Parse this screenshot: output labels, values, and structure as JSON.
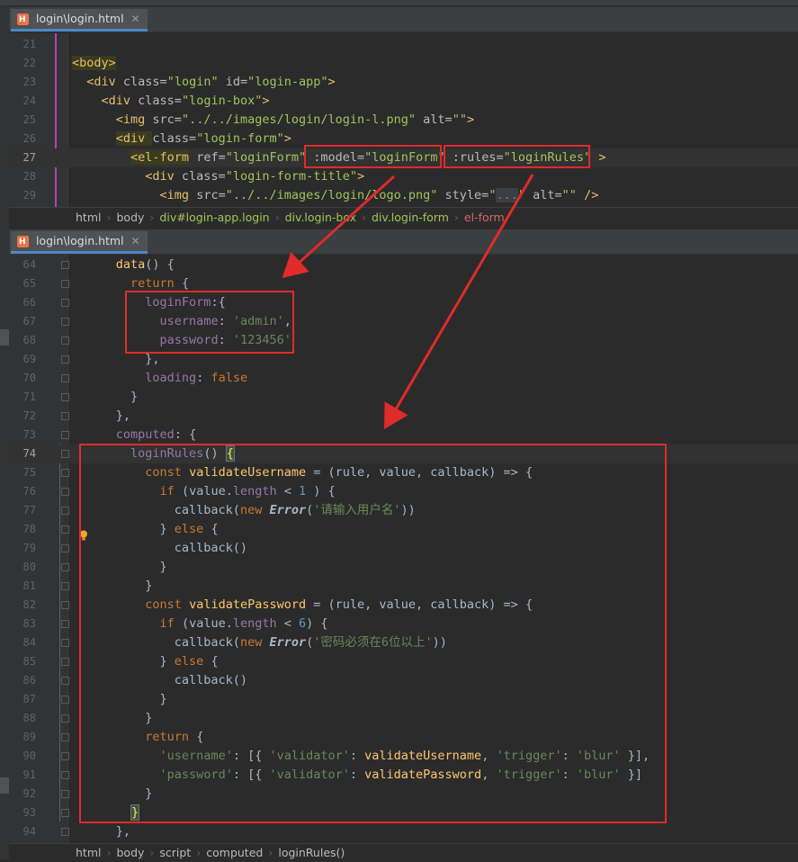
{
  "tab1": {
    "label": "login\\login.html",
    "close": "✕"
  },
  "tab2": {
    "label": "login\\login.html",
    "close": "✕"
  },
  "editor1_lines": [
    {
      "n": "21",
      "html": ""
    },
    {
      "n": "22",
      "html": "<span class=\"t-tagbg\">&lt;body&gt;</span>"
    },
    {
      "n": "23",
      "html": "  <span class=\"t-tag\">&lt;div </span><span class=\"t-attr\">class=</span><span class=\"t-str\">\"login\"</span> <span class=\"t-attr\">id=</span><span class=\"t-str\">\"login-app\"</span><span class=\"t-tag\">&gt;</span>"
    },
    {
      "n": "24",
      "html": "    <span class=\"t-tag\">&lt;div </span><span class=\"t-attr\">class=</span><span class=\"t-str\">\"login-box\"</span><span class=\"t-tag\">&gt;</span>"
    },
    {
      "n": "25",
      "html": "      <span class=\"t-tag\">&lt;img </span><span class=\"t-attr\">src=</span><span class=\"t-str\">\"../../images/login/login-l.png\"</span> <span class=\"t-attr\">alt=</span><span class=\"t-str\">\"\"</span><span class=\"t-tag\">&gt;</span>"
    },
    {
      "n": "26",
      "html": "      <span class=\"t-tagbg\">&lt;div </span><span class=\"t-attr\">class=</span><span class=\"t-str\">\"login-form\"</span><span class=\"t-tag\">&gt;</span>"
    },
    {
      "n": "27",
      "html": "        <span class=\"t-tagbg\">&lt;el-form</span> <span class=\"t-attr\">ref=</span><span class=\"t-str\">\"loginForm\"</span> <span class=\"t-attr\">:model=</span><span class=\"t-str\">\"loginForm\"</span> <span class=\"t-attr\">:rules=</span><span class=\"t-str\">\"loginRules\"</span> <span class=\"t-tag\">&gt;</span>",
      "cur": true
    },
    {
      "n": "28",
      "html": "          <span class=\"t-tag\">&lt;div </span><span class=\"t-attr\">class=</span><span class=\"t-str\">\"login-form-title\"</span><span class=\"t-tag\">&gt;</span>"
    },
    {
      "n": "29",
      "html": "            <span class=\"t-tag\">&lt;img </span><span class=\"t-attr\">src=</span><span class=\"t-str\">\"../../images/login/logo.png\"</span> <span class=\"t-attr\">style=</span><span class=\"t-str\">\"</span><span class=\"t-ghost\">...</span><span class=\"t-str\">\"</span> <span class=\"t-attr\">alt=</span><span class=\"t-str\">\"\"</span> <span class=\"t-tag\">/&gt;</span>"
    }
  ],
  "breadcrumb1": [
    {
      "label": "html",
      "kind": "c-html"
    },
    {
      "label": "body",
      "kind": "c-html"
    },
    {
      "label": "div#login-app.login",
      "kind": "c-tag"
    },
    {
      "label": "div.login-box",
      "kind": "c-tag"
    },
    {
      "label": "div.login-form",
      "kind": "c-tag"
    },
    {
      "label": "el-form",
      "kind": "c-el"
    }
  ],
  "editor2_lines": [
    {
      "n": "64",
      "html": "      <span class=\"t-fn\">data</span>() {"
    },
    {
      "n": "65",
      "html": "        <span class=\"t-kw\">return</span> {"
    },
    {
      "n": "66",
      "html": "          <span class=\"t-prop\">loginForm</span>:{"
    },
    {
      "n": "67",
      "html": "            <span class=\"t-prop\">username</span>: <span class=\"t-sstr\">'admin'</span>,"
    },
    {
      "n": "68",
      "html": "            <span class=\"t-prop\">password</span>: <span class=\"t-sstr\">'123456'</span>"
    },
    {
      "n": "69",
      "html": "          },"
    },
    {
      "n": "70",
      "html": "          <span class=\"t-prop\">loading</span>: <span class=\"t-kw\">false</span>"
    },
    {
      "n": "71",
      "html": "        }"
    },
    {
      "n": "72",
      "html": "      },"
    },
    {
      "n": "73",
      "html": "      <span class=\"t-prop\">computed</span>: {"
    },
    {
      "n": "74",
      "html": "        <span class=\"t-prop\">loginRules</span>() <span class=\"bracehl\">{</span>",
      "cur": true
    },
    {
      "n": "75",
      "html": "          <span class=\"t-kw\">const</span> <span class=\"t-fn\">validateUsername</span> = (rule, value, callback) =&gt; {"
    },
    {
      "n": "76",
      "html": "            <span class=\"t-kw\">if</span> (value.<span class=\"t-prop\">length</span> &lt; <span class=\"t-num\">1</span> ) {"
    },
    {
      "n": "77",
      "html": "              callback(<span class=\"t-kw\">new</span> <span class=\"t-cls\">Error</span>(<span class=\"t-sstr\">'请输入用户名'</span>))"
    },
    {
      "n": "78",
      "html": "            } <span class=\"t-kw\">else</span> {"
    },
    {
      "n": "79",
      "html": "              callback()"
    },
    {
      "n": "80",
      "html": "            }"
    },
    {
      "n": "81",
      "html": "          }"
    },
    {
      "n": "82",
      "html": "          <span class=\"t-kw\">const</span> <span class=\"t-fn\">validatePassword</span> = (rule, value, callback) =&gt; {"
    },
    {
      "n": "83",
      "html": "            <span class=\"t-kw\">if</span> (value.<span class=\"t-prop\">length</span> &lt; <span class=\"t-num\">6</span>) {"
    },
    {
      "n": "84",
      "html": "              callback(<span class=\"t-kw\">new</span> <span class=\"t-cls\">Error</span>(<span class=\"t-sstr\">'密码必须在6位以上'</span>))"
    },
    {
      "n": "85",
      "html": "            } <span class=\"t-kw\">else</span> {"
    },
    {
      "n": "86",
      "html": "              callback()"
    },
    {
      "n": "87",
      "html": "            }"
    },
    {
      "n": "88",
      "html": "          }"
    },
    {
      "n": "89",
      "html": "          <span class=\"t-kw\">return</span> {"
    },
    {
      "n": "90",
      "html": "            <span class=\"t-sstr\">'username'</span>: [{ <span class=\"t-sstr\">'validator'</span>: <span class=\"t-fn\">validateUsername</span>, <span class=\"t-sstr\">'trigger'</span>: <span class=\"t-sstr\">'blur'</span> }],"
    },
    {
      "n": "91",
      "html": "            <span class=\"t-sstr\">'password'</span>: [{ <span class=\"t-sstr\">'validator'</span>: <span class=\"t-fn\">validatePassword</span>, <span class=\"t-sstr\">'trigger'</span>: <span class=\"t-sstr\">'blur'</span> }]"
    },
    {
      "n": "92",
      "html": "          }"
    },
    {
      "n": "93",
      "html": "        <span class=\"bracehl\">}</span>"
    },
    {
      "n": "94",
      "html": "      },"
    }
  ],
  "breadcrumb2": [
    {
      "label": "html",
      "kind": "c-html"
    },
    {
      "label": "body",
      "kind": "c-html"
    },
    {
      "label": "script",
      "kind": "c-html"
    },
    {
      "label": "computed",
      "kind": "c-html"
    },
    {
      "label": "loginRules()",
      "kind": "c-html"
    }
  ],
  "colors": {
    "annotation": "#e02b2b",
    "current_line": "#323232",
    "tab_underline": "#4a88c7"
  },
  "icons": {
    "file": "html-file-icon",
    "hint": "lightbulb-icon"
  }
}
